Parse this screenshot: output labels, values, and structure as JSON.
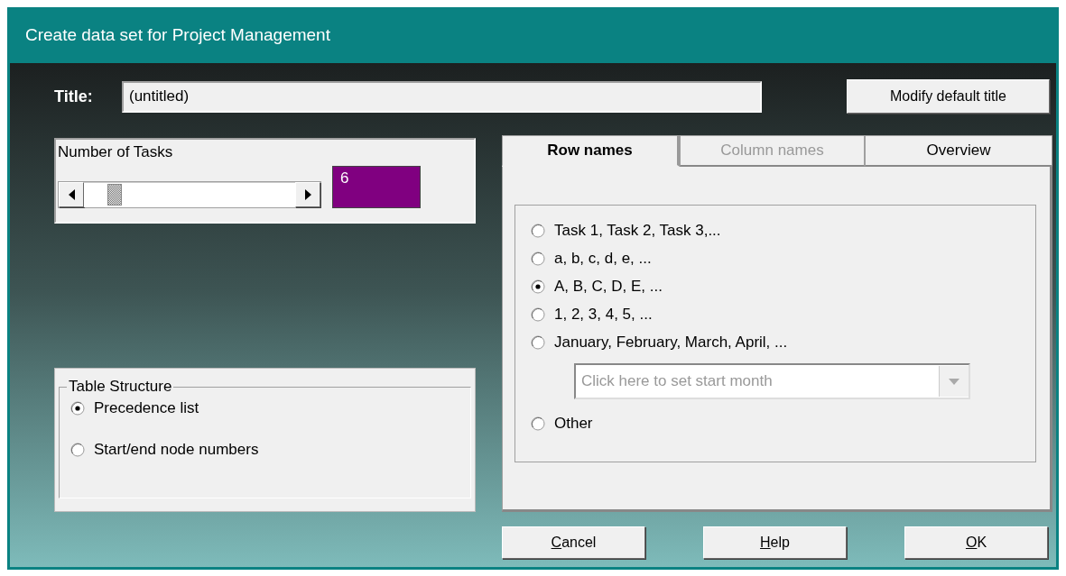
{
  "window": {
    "title": "Create data set for Project Management"
  },
  "title_field": {
    "label": "Title:",
    "value": "(untitled)"
  },
  "modify_button": {
    "label": "Modify default title"
  },
  "number_of_tasks": {
    "label": "Number of Tasks",
    "level": 0.12,
    "value": "6"
  },
  "table_structure": {
    "legend": "Table Structure",
    "options": [
      {
        "label": "Precedence list",
        "selected": true
      },
      {
        "label": "Start/end node numbers",
        "selected": false
      }
    ]
  },
  "tabs": [
    {
      "label": "Row names",
      "selected": true,
      "disabled": false
    },
    {
      "label": "Column names",
      "selected": false,
      "disabled": true
    },
    {
      "label": "Overview",
      "selected": false,
      "disabled": false
    }
  ],
  "row_names": {
    "options": [
      {
        "label": "Task 1, Task 2, Task 3,...",
        "selected": false
      },
      {
        "label": "a, b, c, d, e, ...",
        "selected": false
      },
      {
        "label": "A, B, C, D, E, ...",
        "selected": true
      },
      {
        "label": "1, 2, 3, 4, 5, ...",
        "selected": false
      },
      {
        "label": "January, February, March, April, ...",
        "selected": false,
        "dropdown": {
          "placeholder": "Click here to set start month",
          "disabled": true
        }
      },
      {
        "label": "Other",
        "selected": false
      }
    ]
  },
  "buttons": [
    {
      "label": "Cancel",
      "underline_first": true
    },
    {
      "label": "Help",
      "underline_first": true
    },
    {
      "label": "OK",
      "underline_first": true
    }
  ]
}
